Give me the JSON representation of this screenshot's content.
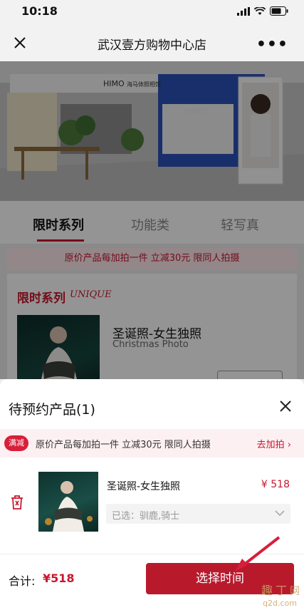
{
  "status_bar": {
    "time": "10:18"
  },
  "nav": {
    "title": "武汉壹方购物中心店"
  },
  "hero": {
    "brand": "HIMO",
    "brand_sub": "海马体照相馆"
  },
  "tabs": [
    {
      "label": "限时系列",
      "active": true
    },
    {
      "label": "功能类",
      "active": false
    },
    {
      "label": "轻写真",
      "active": false
    }
  ],
  "promo_banner": {
    "text": "原价产品每加拍一件 立减30元 限同人拍摄"
  },
  "series_card": {
    "title": "限时系列",
    "subtitle": "UNIQUE",
    "product_name": "圣诞照-女生独照",
    "product_en": "Christmas Photo"
  },
  "sheet": {
    "title": "待预约产品(1)",
    "promo": {
      "badge": "满减",
      "text": "原价产品每加拍一件 立减30元 限同人拍摄",
      "link": "去加拍"
    },
    "item": {
      "name": "圣诞照-女生独照",
      "price": "¥ 518",
      "selected": "已选：驯鹿,骑士"
    }
  },
  "bottom_bar": {
    "total_label": "合计:",
    "total_value": "¥518",
    "cta_label": "选择时间"
  },
  "colors": {
    "accent": "#c7172f",
    "cta": "#b81a2c",
    "badge": "#d81e3a"
  }
}
